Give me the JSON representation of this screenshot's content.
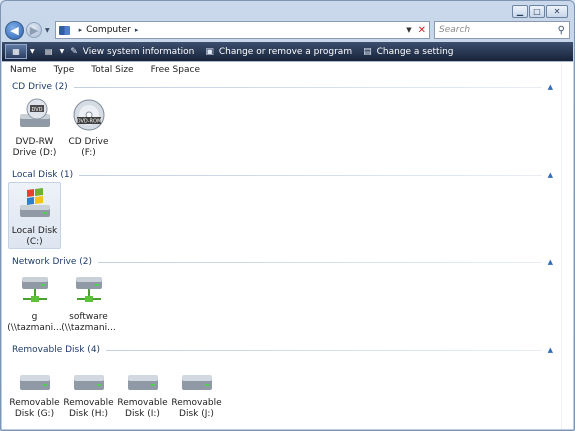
{
  "window": {
    "caption": {
      "minimize": "▁",
      "maximize": "□",
      "close": "✕"
    }
  },
  "nav": {
    "back_glyph": "◀",
    "forward_glyph": "▶",
    "address": {
      "crumbs": [
        "Computer"
      ],
      "separator": "▸"
    },
    "search_placeholder": "Search"
  },
  "toolbar": {
    "items": [
      {
        "label": "View system information",
        "icon": "properties-icon"
      },
      {
        "label": "Change or remove a program",
        "icon": "programs-icon"
      },
      {
        "label": "Change a setting",
        "icon": "control-panel-icon"
      }
    ]
  },
  "columns": [
    "Name",
    "Type",
    "Total Size",
    "Free Space"
  ],
  "groups": [
    {
      "label": "CD Drive (2)",
      "items": [
        {
          "line1": "DVD-RW",
          "line2": "Drive (D:)",
          "icon": "dvd-drive-icon",
          "badge": "DVD"
        },
        {
          "line1": "CD Drive (F:)",
          "line2": "",
          "icon": "dvd-rom-icon",
          "badge": "DVD-ROM"
        }
      ]
    },
    {
      "label": "Local Disk (1)",
      "items": [
        {
          "line1": "Local Disk",
          "line2": "(C:)",
          "icon": "windows-disk-icon"
        }
      ]
    },
    {
      "label": "Network Drive (2)",
      "items": [
        {
          "line1": "g",
          "line2": "(\\\\tazmani...",
          "icon": "network-drive-icon"
        },
        {
          "line1": "software",
          "line2": "(\\\\tazmani...",
          "icon": "network-drive-icon"
        }
      ]
    },
    {
      "label": "Removable Disk (4)",
      "items": [
        {
          "line1": "Removable",
          "line2": "Disk (G:)",
          "icon": "removable-disk-icon"
        },
        {
          "line1": "Removable",
          "line2": "Disk (H:)",
          "icon": "removable-disk-icon"
        },
        {
          "line1": "Removable",
          "line2": "Disk (I:)",
          "icon": "removable-disk-icon"
        },
        {
          "line1": "Removable",
          "line2": "Disk (J:)",
          "icon": "removable-disk-icon"
        }
      ]
    }
  ]
}
